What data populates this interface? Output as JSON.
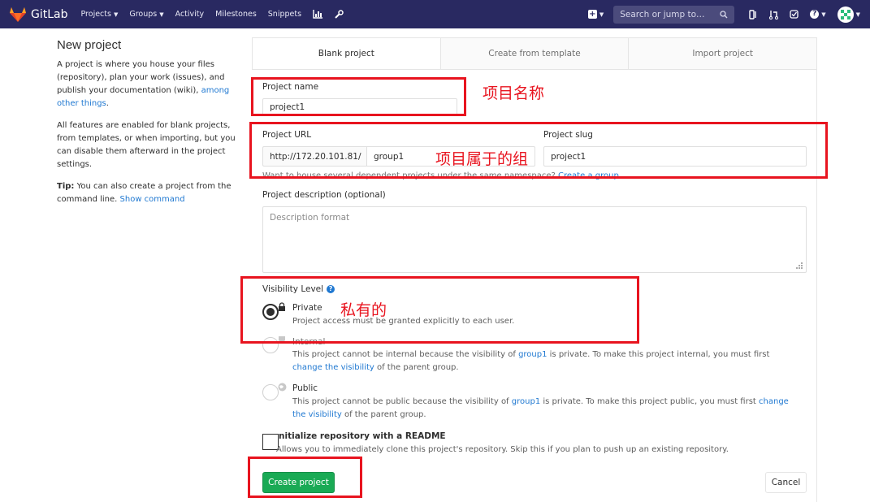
{
  "navbar": {
    "brand": "GitLab",
    "links": [
      "Projects",
      "Groups",
      "Activity",
      "Milestones",
      "Snippets"
    ],
    "search_placeholder": "Search or jump to…",
    "colors": {
      "bar": "#292961",
      "logo": "#e24329"
    }
  },
  "sidebar": {
    "title": "New project",
    "description_pre": "A project is where you house your files (repository), plan your work (issues), and publish your documentation (wiki),",
    "description_link": "among other things",
    "description_end": ".",
    "features": "All features are enabled for blank projects, from templates, or when importing, but you can disable them afterward in the project settings.",
    "tip_label": "Tip:",
    "tip_text": "You can also create a project from the command line.",
    "tip_link": "Show command"
  },
  "tabs": [
    "Blank project",
    "Create from template",
    "Import project"
  ],
  "form": {
    "project_name_label": "Project name",
    "project_name_value": "project1",
    "project_url_label": "Project URL",
    "project_url_prefix": "http://172.20.101.81/",
    "project_url_group": "group1",
    "project_slug_label": "Project slug",
    "project_slug_value": "project1",
    "namespace_help": "Want to house several dependent projects under the same namespace?",
    "namespace_link": "Create a group.",
    "description_label": "Project description (optional)",
    "description_placeholder": "Description format",
    "visibility_label": "Visibility Level",
    "visibility": [
      {
        "title": "Private",
        "desc": "Project access must be granted explicitly to each user.",
        "selected": true
      },
      {
        "title": "Internal",
        "desc_pre": "This project cannot be internal because the visibility of",
        "group": "group1",
        "desc_mid": "is private. To make this project internal, you must first",
        "link": "change the visibility",
        "desc_end": "of the parent group.",
        "selected": false
      },
      {
        "title": "Public",
        "desc_pre": "This project cannot be public because the visibility of",
        "group": "group1",
        "desc_mid": "is private. To make this project public, you must first",
        "link": "change the visibility",
        "desc_end": "of the parent group.",
        "selected": false
      }
    ],
    "readme_title": "nitialize repository with a README",
    "readme_desc": "Allows you to immediately clone this project's repository. Skip this if you plan to push up an existing repository.",
    "readme_checked": false
  },
  "buttons": {
    "create": "Create project",
    "cancel": "Cancel"
  },
  "annotations": {
    "name": "项目名称",
    "group": "项目属于的组",
    "private": "私有的",
    "color": "#e8141f"
  }
}
